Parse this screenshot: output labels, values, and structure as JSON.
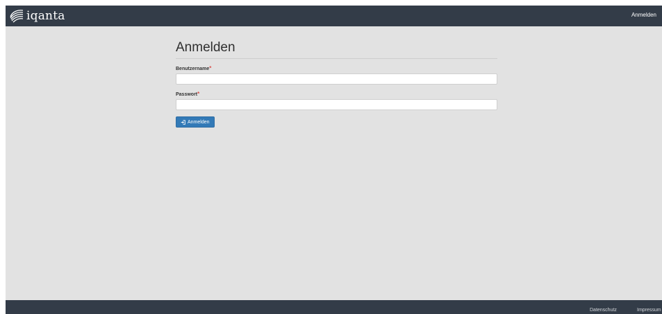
{
  "navbar": {
    "brand_text": "iqanta",
    "brand_icon": "iqanta-swirl-logo",
    "login_link": "Anmelden",
    "background": "#333c48"
  },
  "main": {
    "title": "Anmelden",
    "username": {
      "label": "Benutzername",
      "required_mark": "*",
      "value": "",
      "placeholder": ""
    },
    "password": {
      "label": "Passwort",
      "required_mark": "*",
      "value": "",
      "placeholder": ""
    },
    "submit": {
      "label": "Anmelden",
      "icon": "sign-in-icon",
      "color": "#337ab7"
    },
    "background": "#e2e2e2"
  },
  "footer": {
    "privacy_link": "Datenschutz",
    "imprint_link": "Impressum"
  }
}
